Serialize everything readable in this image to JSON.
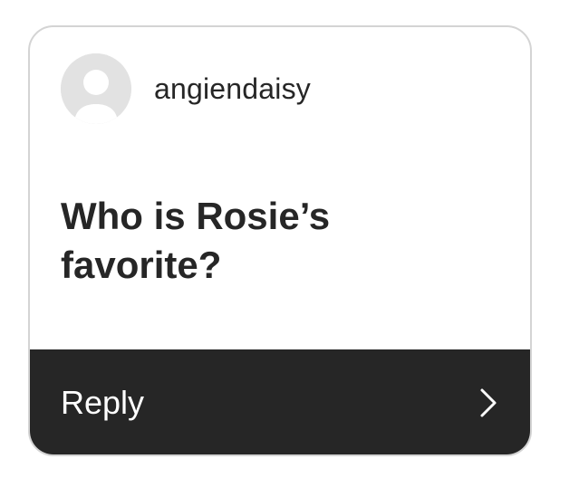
{
  "story_question": {
    "username": "angiendaisy",
    "question": "Who is Rosie’s favorite?",
    "reply_label": "Reply",
    "icons": {
      "avatar": "default-avatar-icon",
      "chevron": "chevron-right-icon"
    },
    "colors": {
      "dark_bar": "#262626",
      "avatar_bg": "#e2e2e2",
      "border": "#d4d4d4"
    }
  }
}
